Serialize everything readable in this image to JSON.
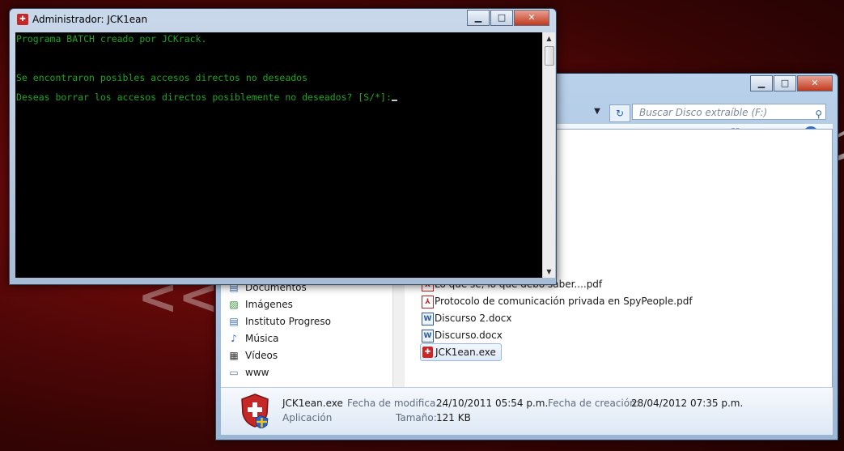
{
  "console": {
    "title": "Administrador:  JCK1ean",
    "lines": [
      "Programa BATCH creado por JCKrack.",
      "Se encontraron posibles accesos directos no deseados",
      "Deseas borrar los accesos directos posiblemente no deseados? [S/*]:"
    ]
  },
  "explorer": {
    "search_placeholder": "Buscar Disco extraíble (F:)",
    "nav_items": [
      {
        "label": "Documentos",
        "icon": "documents-icon"
      },
      {
        "label": "Imágenes",
        "icon": "pictures-icon"
      },
      {
        "label": "Instituto Progreso",
        "icon": "folder-icon"
      },
      {
        "label": "Música",
        "icon": "music-icon"
      },
      {
        "label": "Vídeos",
        "icon": "videos-icon"
      },
      {
        "label": "www",
        "icon": "folder-icon"
      }
    ],
    "files": [
      {
        "name": "Lo que sé, lo que debo saber....pdf",
        "type": "pdf"
      },
      {
        "name": "Protocolo de comunicación privada en SpyPeople.pdf",
        "type": "pdf"
      },
      {
        "name": "Discurso 2.docx",
        "type": "docx"
      },
      {
        "name": "Discurso.docx",
        "type": "docx"
      },
      {
        "name": "JCK1ean.exe",
        "type": "exe",
        "selected": true
      }
    ],
    "details": {
      "name": "JCK1ean.exe",
      "type": "Aplicación",
      "modified_label": "Fecha de modifica...",
      "modified_value": "24/10/2011 05:54 p.m.",
      "created_label": "Fecha de creación:",
      "created_value": "28/04/2012 07:35 p.m.",
      "size_label": "Tamaño:",
      "size_value": "121 KB"
    }
  },
  "colors": {
    "terminal_text": "#1ea51e",
    "terminal_bg": "#000000",
    "desktop_red": "#6a0a0a"
  }
}
